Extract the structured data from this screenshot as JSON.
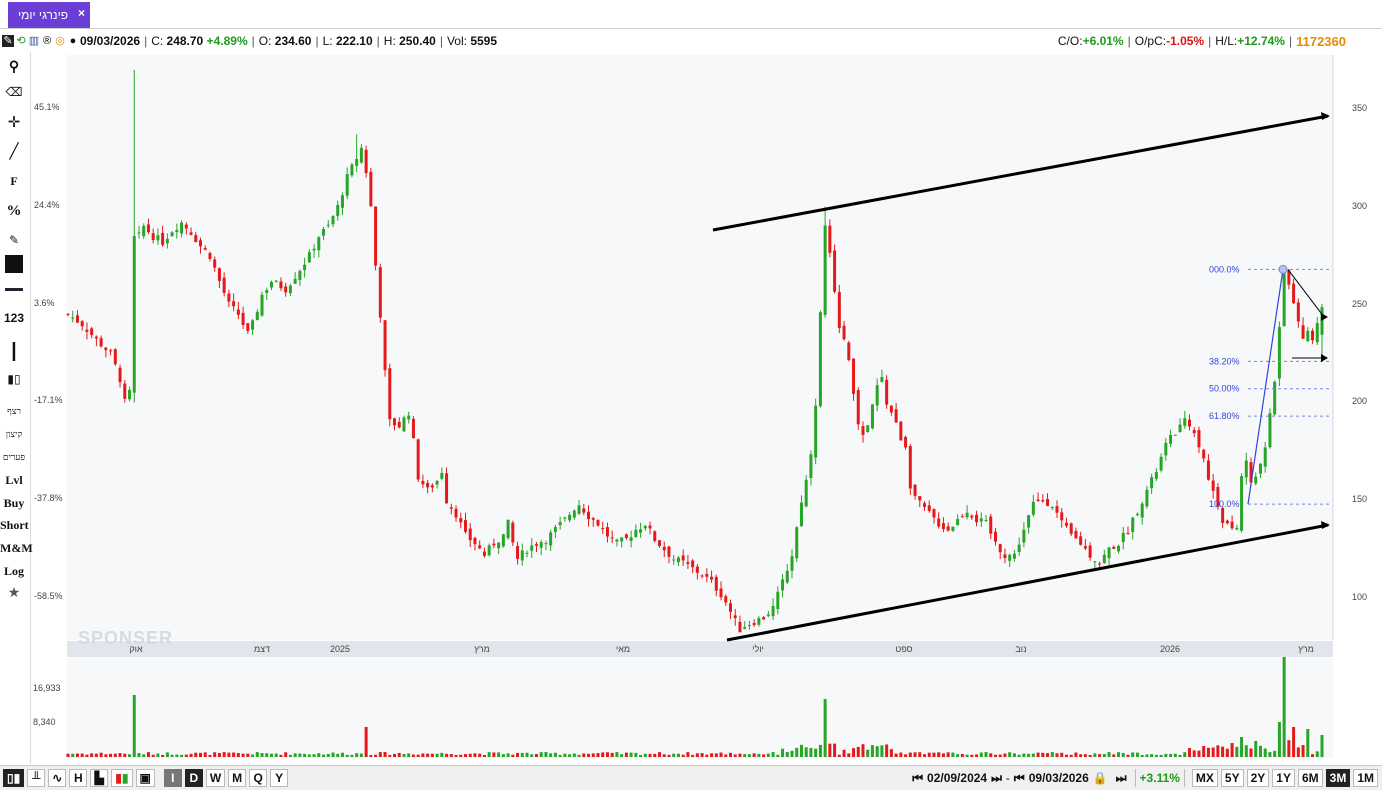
{
  "tab": {
    "label": "פינרגי יומי",
    "close": "×"
  },
  "info": {
    "date": "09/03/2026",
    "c_label": "C:",
    "c_value": "248.70",
    "c_change": "+4.89%",
    "o_label": "O:",
    "o_value": "234.60",
    "l_label": "L:",
    "l_value": "222.10",
    "h_label": "H:",
    "h_value": "250.40",
    "vol_label": "Vol:",
    "vol_value": "5595",
    "co_label": "C/O:",
    "co_value": "+6.01%",
    "opc_label": "O/pC:",
    "opc_value": "-1.05%",
    "hl_label": "H/L:",
    "hl_value": "+12.74%",
    "id": "1172360"
  },
  "tools": {
    "f": "F",
    "pct": "%",
    "num": "123",
    "r1": "רצף",
    "r2": "קיצון",
    "r3": "פערים",
    "lvl": "Lvl",
    "buy": "Buy",
    "short": "Short",
    "mm": "M&M",
    "log": "Log"
  },
  "axes": {
    "pct_labels": [
      "45.1%",
      "24.4%",
      "3.6%",
      "-17.1%",
      "-37.8%",
      "-58.5%"
    ],
    "price_labels": [
      "350",
      "300",
      "250",
      "200",
      "150",
      "100"
    ],
    "x_labels": [
      "אוק",
      "דצמ",
      "2025",
      "מרץ",
      "מאי",
      "יולי",
      "ספט",
      "נוב",
      "2026",
      "מרץ"
    ],
    "vol_labels": [
      "16,933",
      "8,340"
    ]
  },
  "fib": [
    "000.0%",
    "38.20%",
    "50.00%",
    "61.80%",
    "100.0%"
  ],
  "watermark": "SPONSER",
  "bottom": {
    "start_date": "02/09/2024",
    "dash": "-",
    "end_date": "09/03/2026",
    "change": "+3.11%",
    "left_buttons": [
      "H"
    ],
    "period_buttons": [
      "I",
      "D",
      "W",
      "M",
      "Q",
      "Y"
    ],
    "ranges": [
      "MX",
      "5Y",
      "2Y",
      "1Y",
      "6M",
      "3M",
      "1M"
    ]
  },
  "colors": {
    "up": "#26a526",
    "down": "#e51919",
    "tab": "#6b3fd6",
    "fib": "#3344dd"
  },
  "chart_data": {
    "type": "candlestick",
    "title": "",
    "xlabel": "",
    "ylabel": "",
    "ylim": [
      80,
      370
    ],
    "x_range": [
      "2024-09",
      "2026-03"
    ],
    "last": {
      "date": "09/03/2026",
      "open": 234.6,
      "high": 250.4,
      "low": 222.1,
      "close": 248.7,
      "volume": 5595
    },
    "close_path": [
      [
        0,
        245
      ],
      [
        3,
        240
      ],
      [
        6,
        232
      ],
      [
        9,
        225
      ],
      [
        11,
        212
      ],
      [
        12,
        200
      ],
      [
        13,
        205
      ],
      [
        14,
        280
      ],
      [
        16,
        290
      ],
      [
        18,
        285
      ],
      [
        20,
        282
      ],
      [
        22,
        288
      ],
      [
        24,
        292
      ],
      [
        26,
        287
      ],
      [
        28,
        280
      ],
      [
        30,
        275
      ],
      [
        32,
        262
      ],
      [
        34,
        250
      ],
      [
        36,
        245
      ],
      [
        38,
        235
      ],
      [
        39,
        240
      ],
      [
        41,
        255
      ],
      [
        43,
        262
      ],
      [
        46,
        258
      ],
      [
        49,
        268
      ],
      [
        51,
        275
      ],
      [
        53,
        285
      ],
      [
        55,
        290
      ],
      [
        57,
        300
      ],
      [
        59,
        315
      ],
      [
        61,
        325
      ],
      [
        62,
        330
      ],
      [
        63,
        318
      ],
      [
        64,
        300
      ],
      [
        65,
        270
      ],
      [
        66,
        245
      ],
      [
        67,
        215
      ],
      [
        68,
        190
      ],
      [
        70,
        188
      ],
      [
        72,
        195
      ],
      [
        73,
        180
      ],
      [
        74,
        162
      ],
      [
        76,
        155
      ],
      [
        78,
        160
      ],
      [
        79,
        165
      ],
      [
        80,
        150
      ],
      [
        82,
        143
      ],
      [
        84,
        132
      ],
      [
        86,
        128
      ],
      [
        88,
        122
      ],
      [
        90,
        128
      ],
      [
        92,
        132
      ],
      [
        93,
        138
      ],
      [
        94,
        128
      ],
      [
        95,
        120
      ],
      [
        97,
        125
      ],
      [
        99,
        128
      ],
      [
        101,
        130
      ],
      [
        103,
        135
      ],
      [
        105,
        140
      ],
      [
        107,
        146
      ],
      [
        108,
        148
      ],
      [
        110,
        142
      ],
      [
        112,
        138
      ],
      [
        114,
        132
      ],
      [
        116,
        128
      ],
      [
        118,
        130
      ],
      [
        120,
        135
      ],
      [
        122,
        138
      ],
      [
        124,
        130
      ],
      [
        126,
        125
      ],
      [
        128,
        120
      ],
      [
        130,
        118
      ],
      [
        132,
        115
      ],
      [
        134,
        112
      ],
      [
        136,
        108
      ],
      [
        138,
        102
      ],
      [
        139,
        98
      ],
      [
        140,
        93
      ],
      [
        141,
        88
      ],
      [
        142,
        84
      ],
      [
        143,
        86
      ],
      [
        145,
        88
      ],
      [
        147,
        90
      ],
      [
        149,
        95
      ],
      [
        151,
        108
      ],
      [
        153,
        122
      ],
      [
        154,
        136
      ],
      [
        155,
        150
      ],
      [
        156,
        160
      ],
      [
        157,
        175
      ],
      [
        158,
        200
      ],
      [
        159,
        245
      ],
      [
        160,
        290
      ],
      [
        161,
        275
      ],
      [
        162,
        255
      ],
      [
        163,
        240
      ],
      [
        164,
        232
      ],
      [
        165,
        220
      ],
      [
        166,
        205
      ],
      [
        167,
        190
      ],
      [
        168,
        182
      ],
      [
        169,
        188
      ],
      [
        170,
        198
      ],
      [
        171,
        208
      ],
      [
        172,
        212
      ],
      [
        173,
        200
      ],
      [
        174,
        195
      ],
      [
        176,
        182
      ],
      [
        177,
        178
      ],
      [
        178,
        158
      ],
      [
        179,
        152
      ],
      [
        180,
        148
      ],
      [
        182,
        143
      ],
      [
        184,
        138
      ],
      [
        186,
        135
      ],
      [
        188,
        140
      ],
      [
        190,
        145
      ],
      [
        192,
        140
      ],
      [
        194,
        138
      ],
      [
        196,
        128
      ],
      [
        198,
        122
      ],
      [
        200,
        122
      ],
      [
        202,
        135
      ],
      [
        204,
        148
      ],
      [
        206,
        150
      ],
      [
        208,
        148
      ],
      [
        210,
        138
      ],
      [
        212,
        132
      ],
      [
        214,
        128
      ],
      [
        216,
        122
      ],
      [
        218,
        118
      ],
      [
        220,
        125
      ],
      [
        222,
        128
      ],
      [
        224,
        135
      ],
      [
        226,
        145
      ],
      [
        228,
        155
      ],
      [
        230,
        165
      ],
      [
        232,
        178
      ],
      [
        234,
        185
      ],
      [
        236,
        190
      ],
      [
        238,
        186
      ],
      [
        239,
        178
      ],
      [
        240,
        172
      ],
      [
        241,
        160
      ],
      [
        242,
        155
      ],
      [
        243,
        148
      ],
      [
        244,
        140
      ],
      [
        245,
        138
      ],
      [
        246,
        134
      ],
      [
        247,
        136
      ],
      [
        248,
        162
      ],
      [
        249,
        170
      ],
      [
        250,
        158
      ],
      [
        251,
        162
      ],
      [
        252,
        170
      ],
      [
        253,
        175
      ],
      [
        254,
        195
      ],
      [
        255,
        210
      ],
      [
        256,
        240
      ],
      [
        257,
        268
      ],
      [
        258,
        262
      ],
      [
        259,
        252
      ],
      [
        260,
        240
      ],
      [
        261,
        233
      ],
      [
        262,
        238
      ],
      [
        263,
        232
      ],
      [
        264,
        240
      ],
      [
        265,
        248.7
      ]
    ],
    "channel_upper": [
      [
        2025.55,
        290
      ],
      [
        2026.2,
        345
      ]
    ],
    "channel_lower": [
      [
        2025.54,
        84
      ],
      [
        2026.2,
        137
      ]
    ],
    "fib_levels": [
      {
        "label": "000.0%",
        "price": 268
      },
      {
        "label": "38.20%",
        "price": 221
      },
      {
        "label": "50.00%",
        "price": 207
      },
      {
        "label": "61.80%",
        "price": 193
      },
      {
        "label": "100.0%",
        "price": 148
      }
    ],
    "volume_ticks": [
      16933,
      8340
    ]
  }
}
